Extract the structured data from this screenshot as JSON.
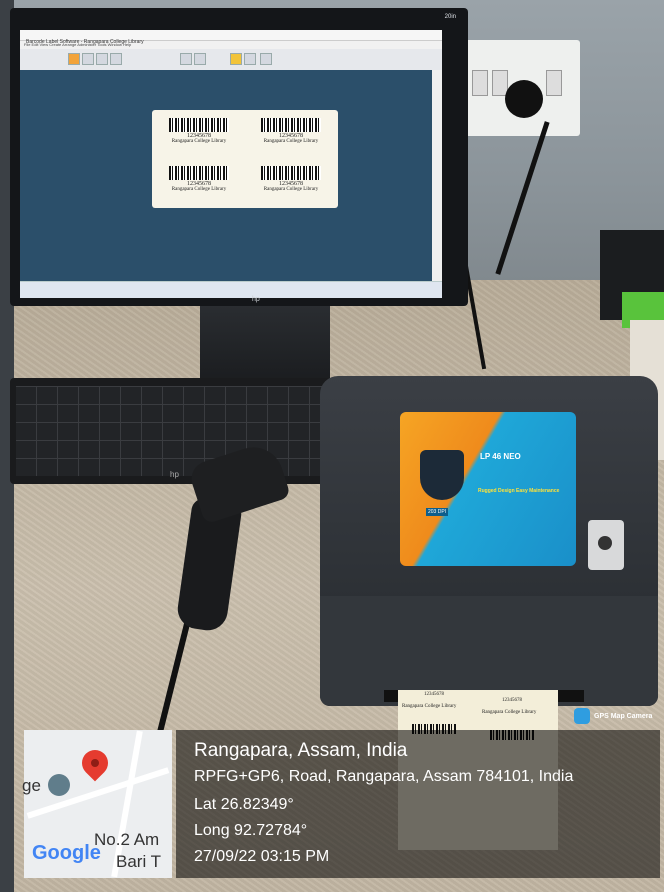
{
  "monitor": {
    "corner_text": "20in",
    "brand": "hp",
    "app_title": "Barcode Label Software - Rangapara College Library",
    "menu": "File  Edit  View  Create  Arrange  Administer  Tools  Window  Help"
  },
  "labels": [
    {
      "number": "12345678",
      "library": "Rangapara College Library"
    },
    {
      "number": "12345678",
      "library": "Rangapara College Library"
    },
    {
      "number": "12345678",
      "library": "Rangapara College Library"
    },
    {
      "number": "12345678",
      "library": "Rangapara College Library"
    }
  ],
  "keyboard": {
    "brand": "hp"
  },
  "printer": {
    "model": "LP 46 NEO",
    "tagline": "Rugged Design Easy Maintenance",
    "dpi": "203 DPI"
  },
  "printed_labels": {
    "number": "12345678",
    "library": "Rangapara College Library"
  },
  "gps_overlay": {
    "app_name": "GPS Map Camera",
    "place": "Rangapara, Assam, India",
    "address": "RPFG+GP6, Road, Rangapara, Assam 784101, India",
    "lat": "Lat 26.82349°",
    "long": "Long 92.72784°",
    "datetime": "27/09/22 03:15 PM",
    "map_text_left": "ge",
    "map_text_right_1": "No.2 Am",
    "map_text_right_2": "Bari T",
    "map_logo": "Google"
  },
  "colors": {
    "pin": "#e53b2f",
    "canvas": "#2b4f6a",
    "sticker_orange": "#f6a524",
    "sticker_blue": "#1fa7d8"
  },
  "icons": [
    "map-pin-icon",
    "graduation-cap-icon",
    "gps-camera-icon"
  ]
}
